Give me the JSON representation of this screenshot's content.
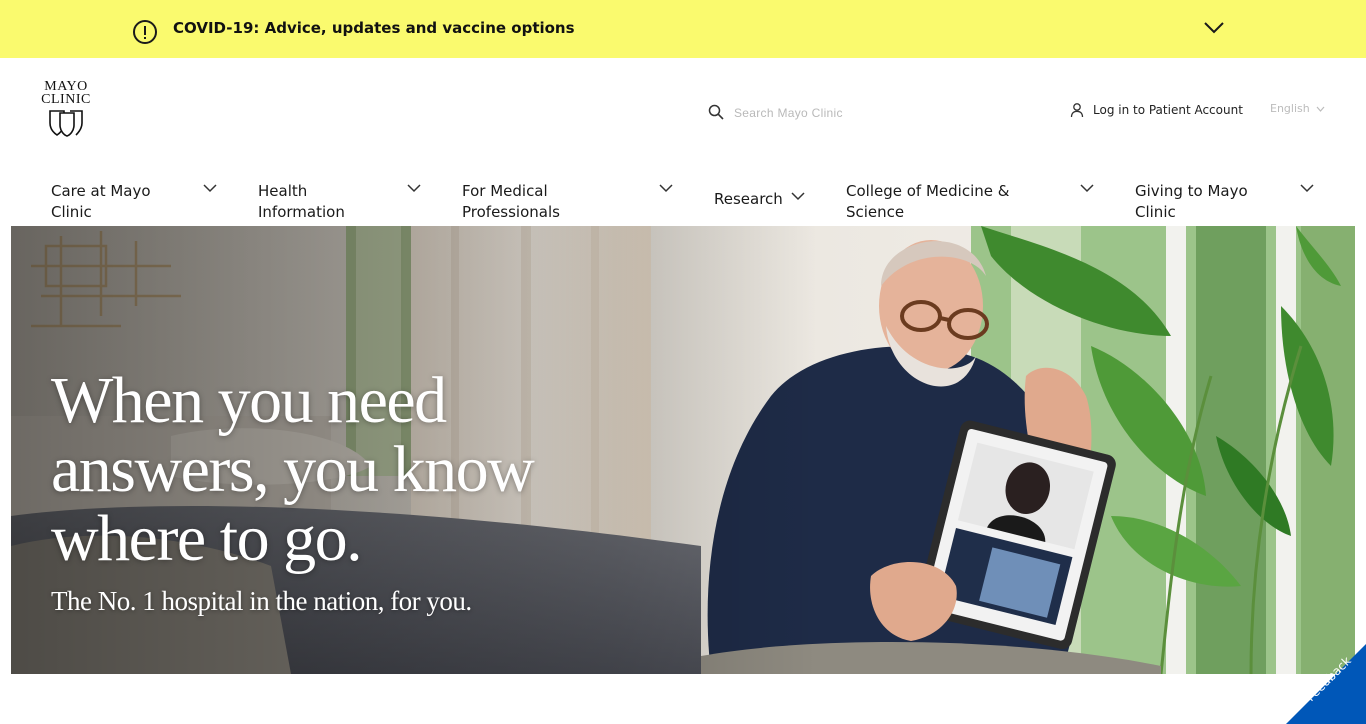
{
  "covid_banner": {
    "text": "COVID-19: Advice, updates and vaccine options",
    "bg_color": "#fafa6e"
  },
  "header": {
    "logo_line1": "MAYO",
    "logo_line2": "CLINIC",
    "search_placeholder": "Search Mayo Clinic",
    "login_label": "Log in to Patient Account",
    "language_label": "English"
  },
  "nav": {
    "items": [
      {
        "label_line1": "Care at Mayo",
        "label_line2": "Clinic"
      },
      {
        "label_line1": "Health",
        "label_line2": "Information"
      },
      {
        "label_line1": "For Medical",
        "label_line2": "Professionals"
      },
      {
        "label_line1": "Research",
        "label_line2": ""
      },
      {
        "label_line1": "College of Medicine &",
        "label_line2": "Science"
      },
      {
        "label_line1": "Giving to Mayo",
        "label_line2": "Clinic"
      }
    ]
  },
  "hero": {
    "heading_line1": "When you need",
    "heading_line2": "answers, you know",
    "heading_line3": "where to go.",
    "subheading": "The No. 1 hospital in the nation, for you."
  },
  "feedback": {
    "label": "Feedback",
    "color": "#0057b8"
  },
  "icons": [
    "alert-circle-icon",
    "chevron-down-icon",
    "search-icon",
    "person-icon"
  ]
}
